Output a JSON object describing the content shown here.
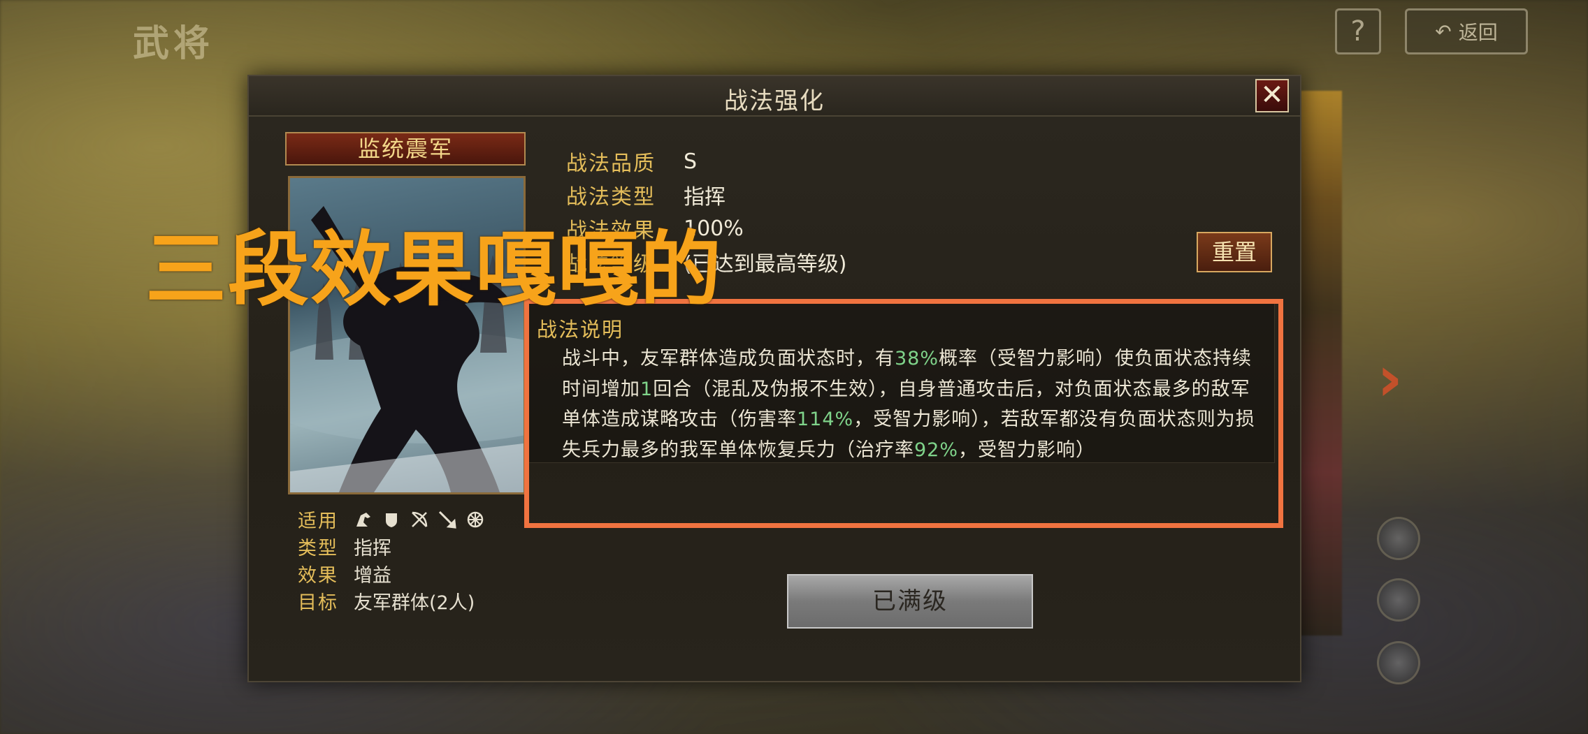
{
  "background": {
    "screen_title": "武将",
    "help_label": "?",
    "back_label": "返回"
  },
  "dialog": {
    "title": "战法强化",
    "close_glyph": "✕"
  },
  "skill": {
    "name": "监统震军",
    "applicable_label": "适用",
    "troop_icons": [
      "cavalry-icon",
      "shield-icon",
      "bow-icon",
      "spear-icon",
      "siege-icon"
    ],
    "stats": [
      {
        "label": "类型",
        "value": "指挥"
      },
      {
        "label": "效果",
        "value": "增益"
      },
      {
        "label": "目标",
        "value": "友军群体(2人)"
      }
    ]
  },
  "info": {
    "rows": [
      {
        "label": "战法品质",
        "value": "S"
      },
      {
        "label": "战法类型",
        "value": "指挥"
      },
      {
        "label": "战法效果",
        "value": "100%"
      },
      {
        "label": "战法等级",
        "value": "(已达到最高等级)"
      }
    ],
    "reset_label": "重置"
  },
  "description": {
    "title": "战法说明",
    "segments": [
      {
        "text": "战斗中，友军群体造成负面状态时，有",
        "hl": false
      },
      {
        "text": "38%",
        "hl": true
      },
      {
        "text": "概率（受智力影响）使负面状态持续时间增加",
        "hl": false
      },
      {
        "text": "1",
        "hl": true
      },
      {
        "text": "回合（混乱及伪报不生效），自身普通攻击后，对负面状态最多的敌军单体造成谋略攻击（伤害率",
        "hl": false
      },
      {
        "text": "114%",
        "hl": true
      },
      {
        "text": "，受智力影响），若敌军都没有负面状态则为损失兵力最多的我军单体恢复兵力（治疗率",
        "hl": false
      },
      {
        "text": "92%",
        "hl": true
      },
      {
        "text": "，受智力影响）",
        "hl": false
      }
    ]
  },
  "maxed_label": "已满级",
  "overlay_caption": "三段效果嘎嘎的",
  "colors": {
    "highlight": "#7fd38a",
    "gold_label": "#e4bd5a",
    "annotation_border": "#f07340",
    "caption": "#f7a31a"
  }
}
